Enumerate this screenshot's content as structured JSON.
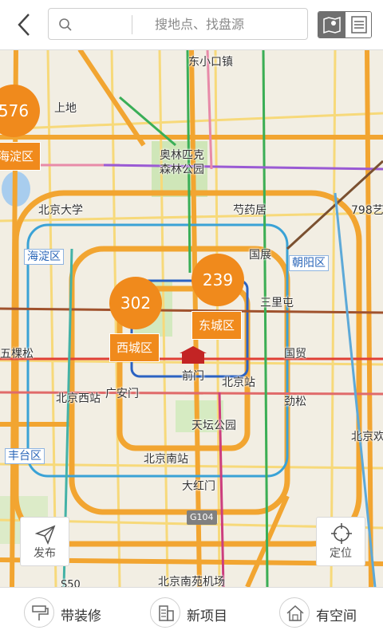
{
  "header": {
    "search_placeholder": "搜地点、找盘源"
  },
  "map": {
    "labels": {
      "dongxiaokou": "东小口镇",
      "shangdi": "上地",
      "olympic_park": "奥林匹克\n森林公园",
      "pku": "北京大学",
      "shaoyaoju": "芍药居",
      "n798": "798艺",
      "haidian_district": "海淀区",
      "guozhan": "国展",
      "chaoyang_district": "朝阳区",
      "sanlitun": "三里屯",
      "wukesong": "五棵松",
      "guomao": "国贸",
      "qianmen": "前门",
      "beijing_station": "北京站",
      "beijing_west": "北京西站",
      "guanganmen": "广安门",
      "jinsong": "劲松",
      "tiantan": "天坛公园",
      "beijing_huan": "北京欢",
      "fengtai_district": "丰台区",
      "beijing_south": "北京南站",
      "dahongmen": "大红门",
      "g104": "G104",
      "nanyuan_airport": "北京南苑机场",
      "s50": "S50"
    },
    "clusters": [
      {
        "count": "576",
        "district": "海淀区"
      },
      {
        "count": "302",
        "district": "西城区"
      },
      {
        "count": "239",
        "district": "东城区"
      }
    ],
    "publish_label": "发布",
    "locate_label": "定位"
  },
  "bottom": {
    "tabs": [
      {
        "label": "带装修"
      },
      {
        "label": "新项目"
      },
      {
        "label": "有空间"
      }
    ]
  }
}
